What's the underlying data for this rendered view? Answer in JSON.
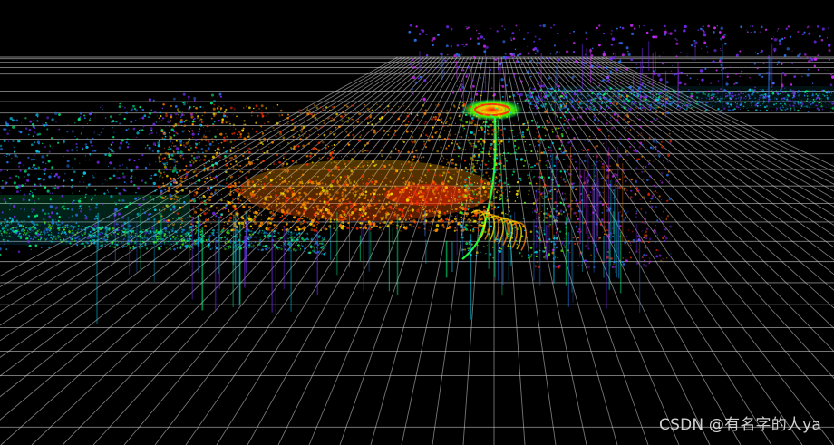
{
  "viewer": {
    "background": "#000000",
    "grid_color": "#d8d8d8",
    "colormap": [
      "#ff2a00",
      "#ff8a00",
      "#ffe600",
      "#66ff00",
      "#00ff88",
      "#00d9ff",
      "#2a7bff",
      "#7a2bff",
      "#d12bff"
    ]
  },
  "watermark": {
    "text": "CSDN @有名字的人ya"
  }
}
